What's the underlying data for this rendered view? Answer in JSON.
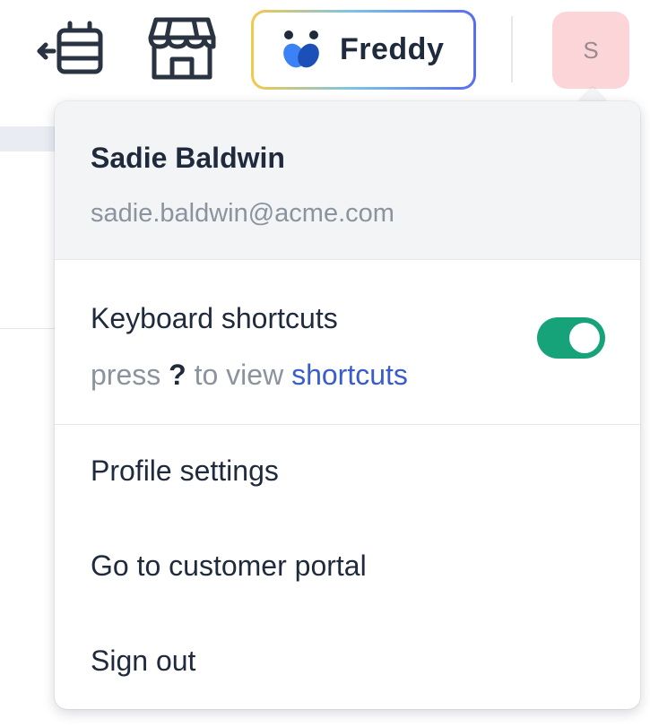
{
  "toolbar": {
    "icons": {
      "timeline": "timeline-icon",
      "store": "store-icon",
      "freddy_logo": "freddy-logo-icon"
    },
    "freddy_label": "Freddy",
    "avatar_initial": "S"
  },
  "user": {
    "name": "Sadie Baldwin",
    "email": "sadie.baldwin@acme.com"
  },
  "shortcuts": {
    "title": "Keyboard shortcuts",
    "hint_prefix": "press",
    "hint_key": "?",
    "hint_middle": "to view",
    "hint_link": "shortcuts",
    "enabled": true
  },
  "menu": {
    "profile_settings": "Profile settings",
    "customer_portal": "Go to customer portal",
    "sign_out": "Sign out"
  },
  "colors": {
    "toggle_on": "#16a37a",
    "link": "#3b5ccc",
    "avatar_bg": "#fbd5d8",
    "header_bg": "#f3f4f6"
  }
}
